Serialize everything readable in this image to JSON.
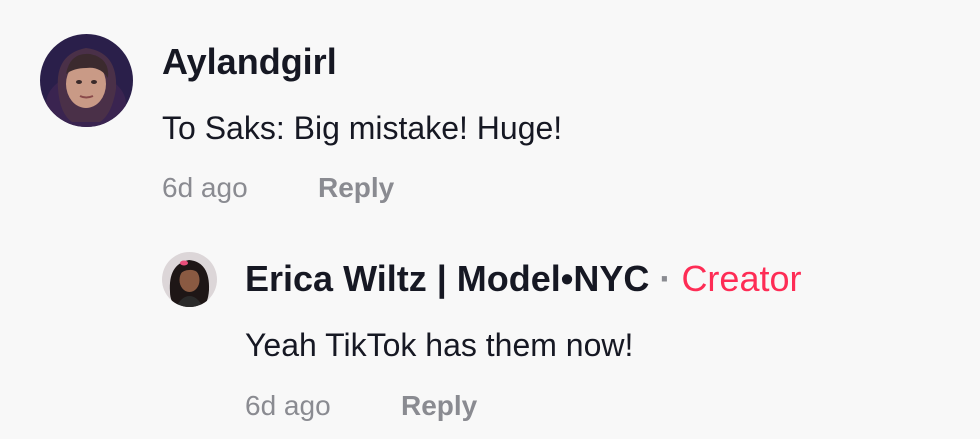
{
  "comments": [
    {
      "username": "Aylandgirl",
      "text": "To Saks: Big mistake! Huge!",
      "time": "6d ago",
      "reply_label": "Reply"
    }
  ],
  "replies": [
    {
      "username": "Erica Wiltz | Model•NYC",
      "separator": "·",
      "badge": "Creator",
      "text": "Yeah TikTok has them now!",
      "time": "6d ago",
      "reply_label": "Reply"
    }
  ],
  "colors": {
    "background": "#f8f8f8",
    "text_primary": "#161823",
    "text_secondary": "#8a8b91",
    "creator_accent": "#fe2c55"
  }
}
